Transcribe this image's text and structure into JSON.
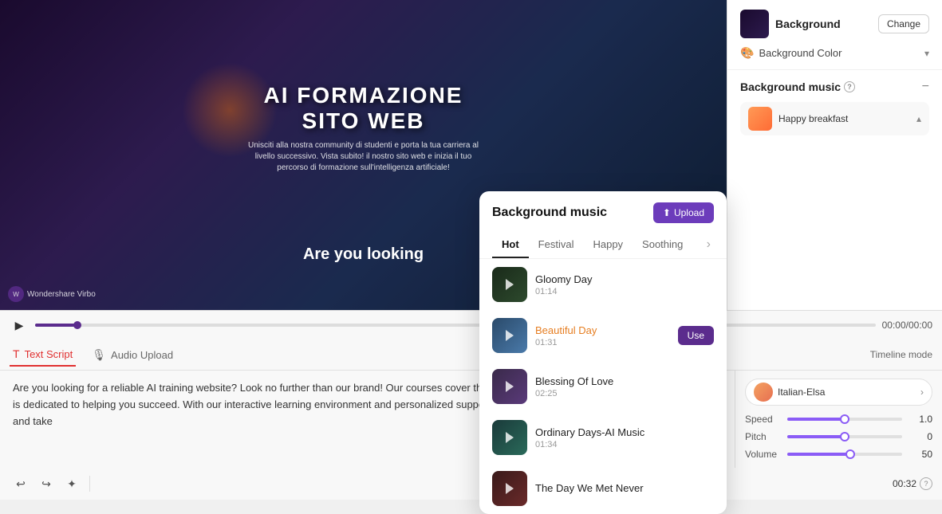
{
  "header": {},
  "video": {
    "title_line1": "AI FORMAZIONE",
    "title_line2": "SITO WEB",
    "subtitle": "Unisciti alla nostra community di studenti e porta la tua carriera al livello successivo. Vista subito! il nostro sito web e inizia il tuo percorso di formazione sull'intelligenza artificiale!",
    "looking_text": "Are you looking",
    "brand": "Wondershare Virbo"
  },
  "timeline": {
    "current_time": "00:00/",
    "end_time": "00:00",
    "time_code": "00:32"
  },
  "tabs": {
    "text_script": "Text Script",
    "audio_upload": "Audio Upload",
    "timeline_mode": "Timeline mode"
  },
  "script": {
    "text": "Are you looking for a reliable AI training website? Look no further than our brand! Our courses cover the latest AI trends and tools, and our team of experts is dedicated to helping you succeed. With our interactive learning environment and personalized support, you will be able to improve your language skills and take"
  },
  "voice": {
    "name": "Italian-Elsa",
    "speed_label": "Speed",
    "speed_value": "1.0",
    "pitch_label": "Pitch",
    "pitch_value": "0",
    "volume_label": "Volume",
    "volume_value": "50"
  },
  "right_panel": {
    "background_label": "Background",
    "change_btn": "Change",
    "bg_color_label": "Background Color",
    "bg_music_title": "Background music",
    "selected_music": "Happy breakfast"
  },
  "music_popup": {
    "title": "Background music",
    "upload_btn": "Upload",
    "tabs": [
      "Hot",
      "Festival",
      "Happy",
      "Soothing"
    ],
    "more_icon": "›",
    "songs": [
      {
        "name": "Gloomy Day",
        "duration": "01:14",
        "art_class": "music-art-gloomy",
        "playing": false
      },
      {
        "name": "Beautiful Day",
        "duration": "01:31",
        "art_class": "music-art-beautiful",
        "playing": true
      },
      {
        "name": "Blessing Of Love",
        "duration": "02:25",
        "art_class": "music-art-blessing",
        "playing": false
      },
      {
        "name": "Ordinary Days-AI Music",
        "duration": "01:34",
        "art_class": "music-art-ordinary",
        "playing": false
      },
      {
        "name": "The Day We Met Never",
        "duration": "",
        "art_class": "music-art-theday",
        "playing": false
      }
    ]
  },
  "toolbar": {
    "undo": "↩",
    "redo": "↪",
    "magic": "✦",
    "help": "?"
  }
}
